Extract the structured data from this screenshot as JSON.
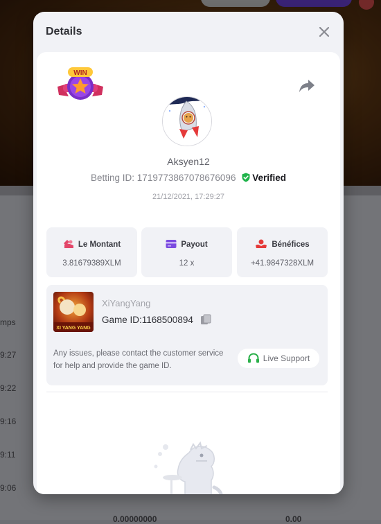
{
  "background": {
    "labels": [
      "mps",
      "9:27",
      "9:22",
      "9:16",
      "9:11",
      "9:06"
    ],
    "bottom_values": [
      "0.00000000",
      "0.00"
    ]
  },
  "modal": {
    "title": "Details",
    "close_icon": "close-icon",
    "win_badge_text": "WIN",
    "user": {
      "name": "Aksyen12",
      "betting_id_label": "Betting ID:",
      "betting_id": "1719773867078676096",
      "verified_label": "Verified",
      "timestamp": "21/12/2021, 17:29:27"
    },
    "stats": [
      {
        "label": "Le Montant",
        "value": "3.81679389XLM",
        "icon": "money-icon",
        "color": "#e3476a"
      },
      {
        "label": "Payout",
        "value": "12 x",
        "icon": "card-icon",
        "color": "#7b4be0"
      },
      {
        "label": "Bénéfices",
        "value": "+41.9847328XLM",
        "icon": "profit-icon",
        "color": "#e53a3a"
      }
    ],
    "game": {
      "name": "XiYangYang",
      "thumb_text": "XI YANG YANG",
      "id_label": "Game ID:",
      "id_value": "1168500894",
      "support_text": "Any issues, please contact the customer service for help and provide the game ID.",
      "live_support_label": "Live Support"
    },
    "colors": {
      "verified": "#1fb34a",
      "support": "#2bb04a",
      "share": "#7d8089"
    }
  }
}
